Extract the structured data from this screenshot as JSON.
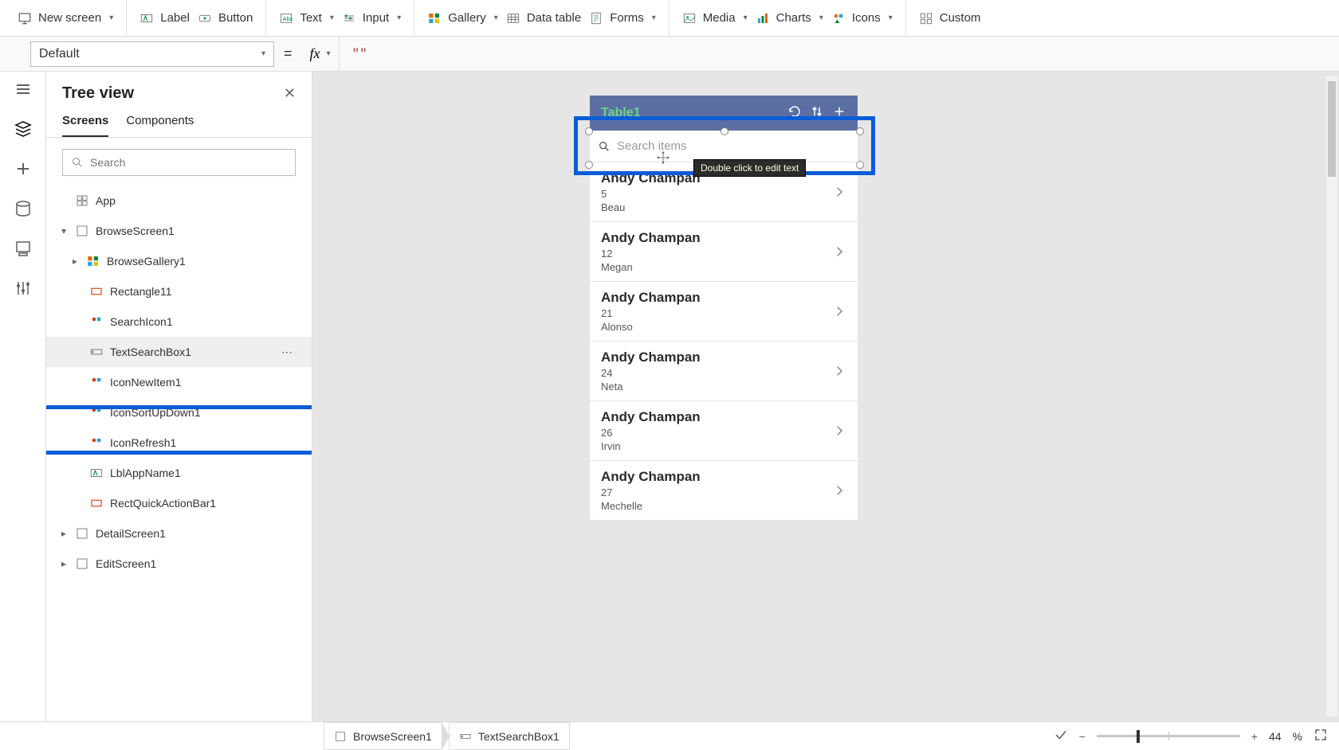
{
  "ribbon": {
    "new_screen": "New screen",
    "label": "Label",
    "button": "Button",
    "text": "Text",
    "input": "Input",
    "gallery": "Gallery",
    "data_table": "Data table",
    "forms": "Forms",
    "media": "Media",
    "charts": "Charts",
    "icons": "Icons",
    "custom": "Custom"
  },
  "propbar": {
    "property": "Default",
    "formula_value": "\"\""
  },
  "tree": {
    "title": "Tree view",
    "tabs": {
      "screens": "Screens",
      "components": "Components"
    },
    "search_placeholder": "Search",
    "app": "App",
    "items": {
      "browse_screen": "BrowseScreen1",
      "browse_gallery": "BrowseGallery1",
      "rectangle11": "Rectangle11",
      "search_icon1": "SearchIcon1",
      "text_search_box1": "TextSearchBox1",
      "icon_new_item1": "IconNewItem1",
      "icon_sort_updown1": "IconSortUpDown1",
      "icon_refresh1": "IconRefresh1",
      "lbl_app_name1": "LblAppName1",
      "rect_quick_action_bar1": "RectQuickActionBar1",
      "detail_screen1": "DetailScreen1",
      "edit_screen1": "EditScreen1"
    }
  },
  "canvas": {
    "app_title": "Table1",
    "search_placeholder": "Search items",
    "tooltip": "Double click to edit text",
    "rows": [
      {
        "name": "Andy Champan",
        "num": "5",
        "sub": "Beau"
      },
      {
        "name": "Andy Champan",
        "num": "12",
        "sub": "Megan"
      },
      {
        "name": "Andy Champan",
        "num": "21",
        "sub": "Alonso"
      },
      {
        "name": "Andy Champan",
        "num": "24",
        "sub": "Neta"
      },
      {
        "name": "Andy Champan",
        "num": "26",
        "sub": "Irvin"
      },
      {
        "name": "Andy Champan",
        "num": "27",
        "sub": "Mechelle"
      }
    ]
  },
  "bottombar": {
    "crumb1": "BrowseScreen1",
    "crumb2": "TextSearchBox1",
    "zoom_value": "44",
    "zoom_pct": "%"
  }
}
